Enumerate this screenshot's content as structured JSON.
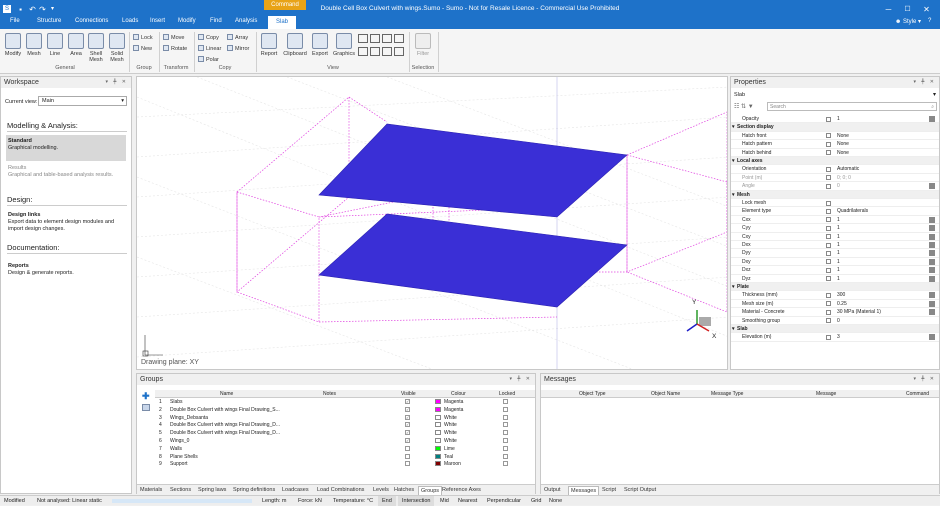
{
  "app": {
    "title": "Double Cell Box Culvert with wings.Sumo - Sumo - Not for Resale Licence - Commercial Use Prohibited",
    "context_tab": "Command",
    "style_label": "Style"
  },
  "ribbon_tabs": [
    "File",
    "Structure",
    "Connections",
    "Loads",
    "Insert",
    "Modify",
    "Find",
    "Analysis",
    "Slab"
  ],
  "ribbon": {
    "general": {
      "modify": "Modify",
      "mesh": "Mesh",
      "line": "Line",
      "area": "Area",
      "shell_mesh": "Shell Mesh",
      "solid_mesh": "Solid Mesh",
      "label": "General"
    },
    "group": {
      "lock": "Lock",
      "new": "New",
      "label": "Group"
    },
    "transform": {
      "move": "Move",
      "rotate": "Rotate",
      "label": "Transform"
    },
    "copy": {
      "copy": "Copy",
      "array": "Array",
      "linear": "Linear",
      "mirror": "Mirror",
      "polar": "Polar",
      "label": "Copy"
    },
    "view": {
      "report": "Report",
      "clipboard": "Clipboard",
      "export": "Export",
      "graphics": "Graphics",
      "label": "View"
    },
    "selection": {
      "filter": "Filter",
      "label": "Selection"
    }
  },
  "workspace": {
    "title": "Workspace",
    "current_view_label": "Current view:",
    "current_view_value": "Main",
    "section1": "Modelling & Analysis:",
    "standard_title": "Standard",
    "standard_desc": "Graphical modelling.",
    "results_title": "Results",
    "results_desc": "Graphical and table-based analysis results.",
    "section2": "Design:",
    "design_title": "Design links",
    "design_desc1": "Export data to element design modules and",
    "design_desc2": "import design changes.",
    "section3": "Documentation:",
    "reports_title": "Reports",
    "reports_desc": "Design & generate reports."
  },
  "viewport": {
    "drawing_plane": "Drawing plane: XY",
    "axis_x": "X",
    "axis_y": "Y"
  },
  "properties": {
    "title": "Properties",
    "object": "Slab",
    "search_placeholder": "Search",
    "rows": [
      {
        "type": "row",
        "name": "Opacity",
        "value": "1",
        "edit": true
      },
      {
        "type": "cat",
        "name": "Section display"
      },
      {
        "type": "row",
        "name": "Hatch front",
        "value": "None"
      },
      {
        "type": "row",
        "name": "Hatch pattern",
        "value": "None"
      },
      {
        "type": "row",
        "name": "Hatch behind",
        "value": "None"
      },
      {
        "type": "cat",
        "name": "Local axes"
      },
      {
        "type": "row",
        "name": "Orientation",
        "value": "Automatic"
      },
      {
        "type": "row",
        "name": "Point (m)",
        "value": "0; 0; 0",
        "grey": true
      },
      {
        "type": "row",
        "name": "Angle",
        "value": "0",
        "grey": true,
        "edit": true
      },
      {
        "type": "cat",
        "name": "Mesh"
      },
      {
        "type": "row",
        "name": "Lock mesh",
        "value": ""
      },
      {
        "type": "row",
        "name": "Element type",
        "value": "Quadrilaterals"
      },
      {
        "type": "row",
        "name": "Cxx",
        "value": "1",
        "edit": true
      },
      {
        "type": "row",
        "name": "Cyy",
        "value": "1",
        "edit": true
      },
      {
        "type": "row",
        "name": "Cxy",
        "value": "1",
        "edit": true
      },
      {
        "type": "row",
        "name": "Dxx",
        "value": "1",
        "edit": true
      },
      {
        "type": "row",
        "name": "Dyy",
        "value": "1",
        "edit": true
      },
      {
        "type": "row",
        "name": "Dxy",
        "value": "1",
        "edit": true
      },
      {
        "type": "row",
        "name": "Dxz",
        "value": "1",
        "edit": true
      },
      {
        "type": "row",
        "name": "Dyz",
        "value": "1",
        "edit": true
      },
      {
        "type": "cat",
        "name": "Plate"
      },
      {
        "type": "row",
        "name": "Thickness (mm)",
        "value": "300",
        "edit": true
      },
      {
        "type": "row",
        "name": "Mesh size (m)",
        "value": "0.25",
        "edit": true
      },
      {
        "type": "row",
        "name": "Material - Concrete",
        "value": "30 MPa (Material 1)",
        "edit": true
      },
      {
        "type": "row",
        "name": "Smoothing group",
        "value": "0"
      },
      {
        "type": "cat",
        "name": "Slab"
      },
      {
        "type": "row",
        "name": "Elevation (m)",
        "value": "3",
        "edit": true
      }
    ]
  },
  "groups": {
    "title": "Groups",
    "headers": {
      "name": "Name",
      "notes": "Notes",
      "visible": "Visible",
      "colour": "Colour",
      "locked": "Locked"
    },
    "rows": [
      {
        "num": "1",
        "name": "Slabs",
        "visible": true,
        "colour": "Magenta",
        "hex": "#ff00ff"
      },
      {
        "num": "2",
        "name": "Double Box Culvert with wings Final Drawing_S...",
        "visible": true,
        "colour": "Magenta",
        "hex": "#ff00ff"
      },
      {
        "num": "3",
        "name": "Wings_Debsanta",
        "visible": true,
        "colour": "White",
        "hex": "#ffffff"
      },
      {
        "num": "4",
        "name": "Double Box Culvert with wings Final Drawing_D...",
        "visible": true,
        "colour": "White",
        "hex": "#ffffff"
      },
      {
        "num": "5",
        "name": "Double Box Culvert with wings Final Drawing_D...",
        "visible": true,
        "colour": "White",
        "hex": "#ffffff"
      },
      {
        "num": "6",
        "name": "Wings_0",
        "visible": true,
        "colour": "White",
        "hex": "#ffffff"
      },
      {
        "num": "7",
        "name": "Walls",
        "visible": false,
        "colour": "Lime",
        "hex": "#00ff00"
      },
      {
        "num": "8",
        "name": "Plane Shells",
        "visible": false,
        "colour": "Teal",
        "hex": "#008080"
      },
      {
        "num": "9",
        "name": "Support",
        "visible": false,
        "colour": "Maroon",
        "hex": "#800000"
      }
    ],
    "tabs": [
      "Materials",
      "Sections",
      "Spring laws",
      "Spring definitions",
      "Loadcases",
      "Load Combinations",
      "Levels",
      "Hatches",
      "Groups",
      "Reference Axes"
    ],
    "active_tab": "Groups"
  },
  "messages": {
    "title": "Messages",
    "headers": [
      "Object Type",
      "Object Name",
      "Message Type",
      "Message",
      "Command"
    ],
    "tabs": [
      "Output",
      "Messages",
      "Script",
      "Script Output"
    ],
    "active_tab": "Messages"
  },
  "status": {
    "mode": "Modified",
    "analysis": "Not analysed: Linear static",
    "length": "Length: m",
    "force": "Force: kN",
    "temperature": "Temperature: °C",
    "snaps": [
      "End",
      "Intersection",
      "Mid",
      "Nearest",
      "Perpendicular",
      "Grid",
      "None"
    ]
  },
  "colors": {
    "accent": "#1e72c9",
    "context": "#e8a317",
    "slab_fill": "#3a2fd6",
    "wall_lines": "#e040e0"
  }
}
